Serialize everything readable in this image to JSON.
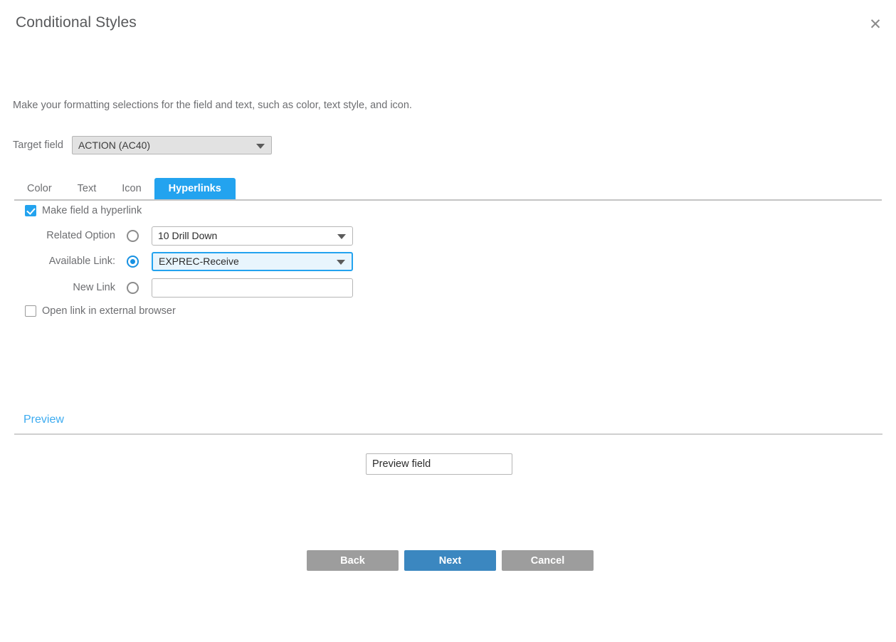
{
  "dialog": {
    "title": "Conditional Styles",
    "close_icon": "close-icon",
    "instruction": "Make your formatting selections for the field and text, such as color, text style, and icon."
  },
  "target_field": {
    "label": "Target field",
    "value": "ACTION (AC40)",
    "caret_icon": "chevron-down-icon"
  },
  "tabs": [
    {
      "label": "Color",
      "active": false
    },
    {
      "label": "Text",
      "active": false
    },
    {
      "label": "Icon",
      "active": false
    },
    {
      "label": "Hyperlinks",
      "active": true
    }
  ],
  "hyperlinks": {
    "make_hyperlink": {
      "label": "Make field a hyperlink",
      "checked": true
    },
    "related_option": {
      "label": "Related Option",
      "selected": false,
      "value": "10 Drill Down",
      "caret_icon": "chevron-down-icon"
    },
    "available_link": {
      "label": "Available Link:",
      "selected": true,
      "value": "EXPREC-Receive",
      "caret_icon": "chevron-down-icon"
    },
    "new_link": {
      "label": "New Link",
      "selected": false,
      "value": "",
      "placeholder": ""
    },
    "open_external": {
      "label": "Open link in external browser",
      "checked": false
    }
  },
  "preview": {
    "title": "Preview",
    "field_text": "Preview field"
  },
  "footer": {
    "back_label": "Back",
    "next_label": "Next",
    "cancel_label": "Cancel"
  },
  "colors": {
    "accent_blue": "#23a3ef",
    "preview_link_blue": "#3cabf0",
    "button_blue": "#3b87c0",
    "button_gray": "#9d9d9d",
    "text_gray": "#6d6e71"
  }
}
